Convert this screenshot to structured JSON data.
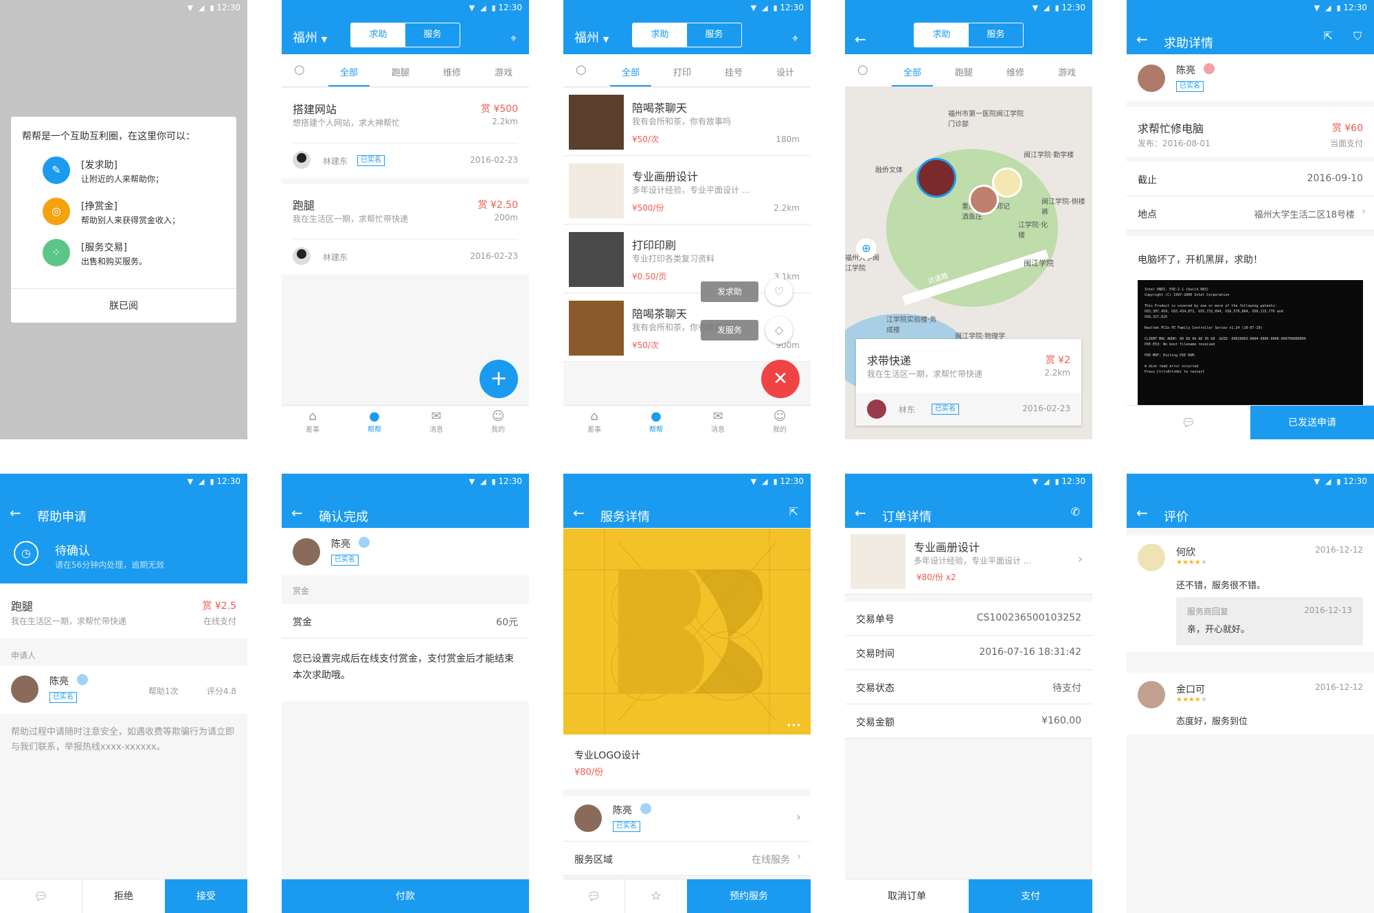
{
  "status": {
    "time": "12:30"
  },
  "s1": {
    "intro": "帮帮是一个互助互利圈，在这里你可以：",
    "items": [
      {
        "title": "[发求助]",
        "desc": "让附近的人来帮助你；"
      },
      {
        "title": "[挣赏金]",
        "desc": "帮助别人来获得赏金收入；"
      },
      {
        "title": "[服务交易]",
        "desc": "出售和购买服务。"
      }
    ],
    "ok": "朕已阅"
  },
  "common": {
    "city": "福州",
    "seg_help": "求助",
    "seg_service": "服务",
    "nav": [
      "差事",
      "帮帮",
      "消息",
      "我的"
    ],
    "verified": "已实名"
  },
  "s2": {
    "tabs": [
      "全部",
      "跑腿",
      "维修",
      "游戏"
    ],
    "tasks": [
      {
        "title": "搭建网站",
        "desc": "想搭建个人网站，求大神帮忙",
        "price": "赏 ¥500",
        "dist": "2.2km",
        "user": "林建东",
        "date": "2016-02-23"
      },
      {
        "title": "跑腿",
        "desc": "我在生活区一期，求帮忙带快递",
        "price": "赏 ¥2.50",
        "dist": "200m",
        "user": "林建东",
        "date": "2016-02-23"
      }
    ],
    "fab": "+"
  },
  "s3": {
    "tabs": [
      "全部",
      "打印",
      "挂号",
      "设计"
    ],
    "services": [
      {
        "title": "陪喝茶聊天",
        "desc": "我有会所和茶，你有故事吗",
        "price": "¥50/次",
        "dist": "180m"
      },
      {
        "title": "专业画册设计",
        "desc": "多年设计经验，专业平面设计 ...",
        "price": "¥500/份",
        "dist": "2.2km"
      },
      {
        "title": "打印印刷",
        "desc": "专业打印各类复习资料",
        "price": "¥0.50/页",
        "dist": "3.1km"
      },
      {
        "title": "陪喝茶聊天",
        "desc": "我有会所和茶，你有故事吗",
        "price": "¥50/次",
        "dist": "900m"
      }
    ],
    "menu_help": "发求助",
    "menu_service": "发服务"
  },
  "s4": {
    "tabs": [
      "全部",
      "跑腿",
      "维修",
      "游戏"
    ],
    "places": [
      "福州市第一医院闽江学院门诊部",
      "闽江学院·勤学楼",
      "融侨文体",
      "闽江学院-侧楼裤",
      "重庆肖公馆郑记酒鱼庄",
      "闽江学院",
      "江学院·化楼",
      "江学院实验楼·务成楼",
      "闽江学院·物理学",
      "福州大学闽江学院",
      "达道路"
    ],
    "card": {
      "title": "求带快递",
      "desc": "我在生活区一期，求帮忙带快递",
      "price": "赏 ¥2",
      "dist": "2.2km",
      "user": "林东",
      "date": "2016-02-23"
    }
  },
  "s5": {
    "title": "求助详情",
    "user": "陈亮",
    "task": "求帮忙修电脑",
    "price": "赏 ¥60",
    "posted": "发布：2016-08-01",
    "pay": "当面支付",
    "deadline_label": "截止",
    "deadline": "2016-09-10",
    "loc_label": "地点",
    "loc": "福州大学生活二区18号楼",
    "msg": "电脑坏了，开机黑屏，求助！",
    "btn": "已发送申请",
    "screen_text": "Intel UNDI, PXE-2.1 (build 083)\nCopyright (C) 1997-2000 Intel Corporation\n\nThis Product is covered by one or more of the following patents:\nUS5,307,459, US5,434,872, US5,732,094, US6,570,884, US6,115,776 and\nUS6,327,625\n\nRealtek PCIe FE Family Controller Series v1.24 (10-07-10)\n\nCLIENT MAC ADDR: 00 E0 66 A8 35 68  GUID: 00020003-0004-0005-0006-000700080009\nPXE-E53: No boot filename received\n\nPXE-M0F: Exiting PXE ROM.\n\nA disk read error occurred\nPress Ctrl+Alt+Del to restart"
  },
  "s6": {
    "title": "帮助申请",
    "status": "待确认",
    "status_sub": "请在56分钟内处理，逾期无效",
    "task": "跑腿",
    "desc": "我在生活区一期，求帮忙带快递",
    "price": "赏 ¥2.5",
    "pay": "在线支付",
    "applicant_label": "申请人",
    "user": "陈亮",
    "helped": "帮助1次",
    "score": "评分4.8",
    "warn": "帮助过程中请随时注意安全，如遇收费等欺骗行为请立即与我们联系，举报热线xxxx-xxxxxx。",
    "reject": "拒绝",
    "accept": "接受"
  },
  "s7": {
    "title": "确认完成",
    "user": "陈亮",
    "reward_section": "赏金",
    "reward_label": "赏金",
    "reward": "60元",
    "note": "您已设置完成后在线支付赏金，支付赏金后才能结束本次求助哦。",
    "btn": "付款"
  },
  "s8": {
    "title": "服务详情",
    "name": "专业LOGO设计",
    "price": "¥80/份",
    "user": "陈亮",
    "area_label": "服务区域",
    "area": "在线服务",
    "btn": "预约服务"
  },
  "s9": {
    "title": "订单详情",
    "item": "专业画册设计",
    "desc": "多年设计经验，专业平面设计 ...",
    "price": "¥80/份 x2",
    "rows": [
      {
        "label": "交易单号",
        "value": "CS100236500103252"
      },
      {
        "label": "交易时间",
        "value": "2016-07-16 18:31:42"
      },
      {
        "label": "交易状态",
        "value": "待支付"
      },
      {
        "label": "交易金额",
        "value": "¥160.00"
      }
    ],
    "cancel": "取消订单",
    "pay": "支付"
  },
  "s10": {
    "title": "评价",
    "reviews": [
      {
        "user": "何欣",
        "date": "2016-12-12",
        "text": "还不错，服务很不错。",
        "reply_label": "服务商回复",
        "reply_date": "2016-12-13",
        "reply": "亲，开心就好。"
      },
      {
        "user": "金口可",
        "date": "2016-12-12",
        "text": "态度好，服务到位"
      }
    ]
  },
  "colors": {
    "primary": "#1a9bf0",
    "price": "#f05a50",
    "fab_red": "#f04444"
  }
}
